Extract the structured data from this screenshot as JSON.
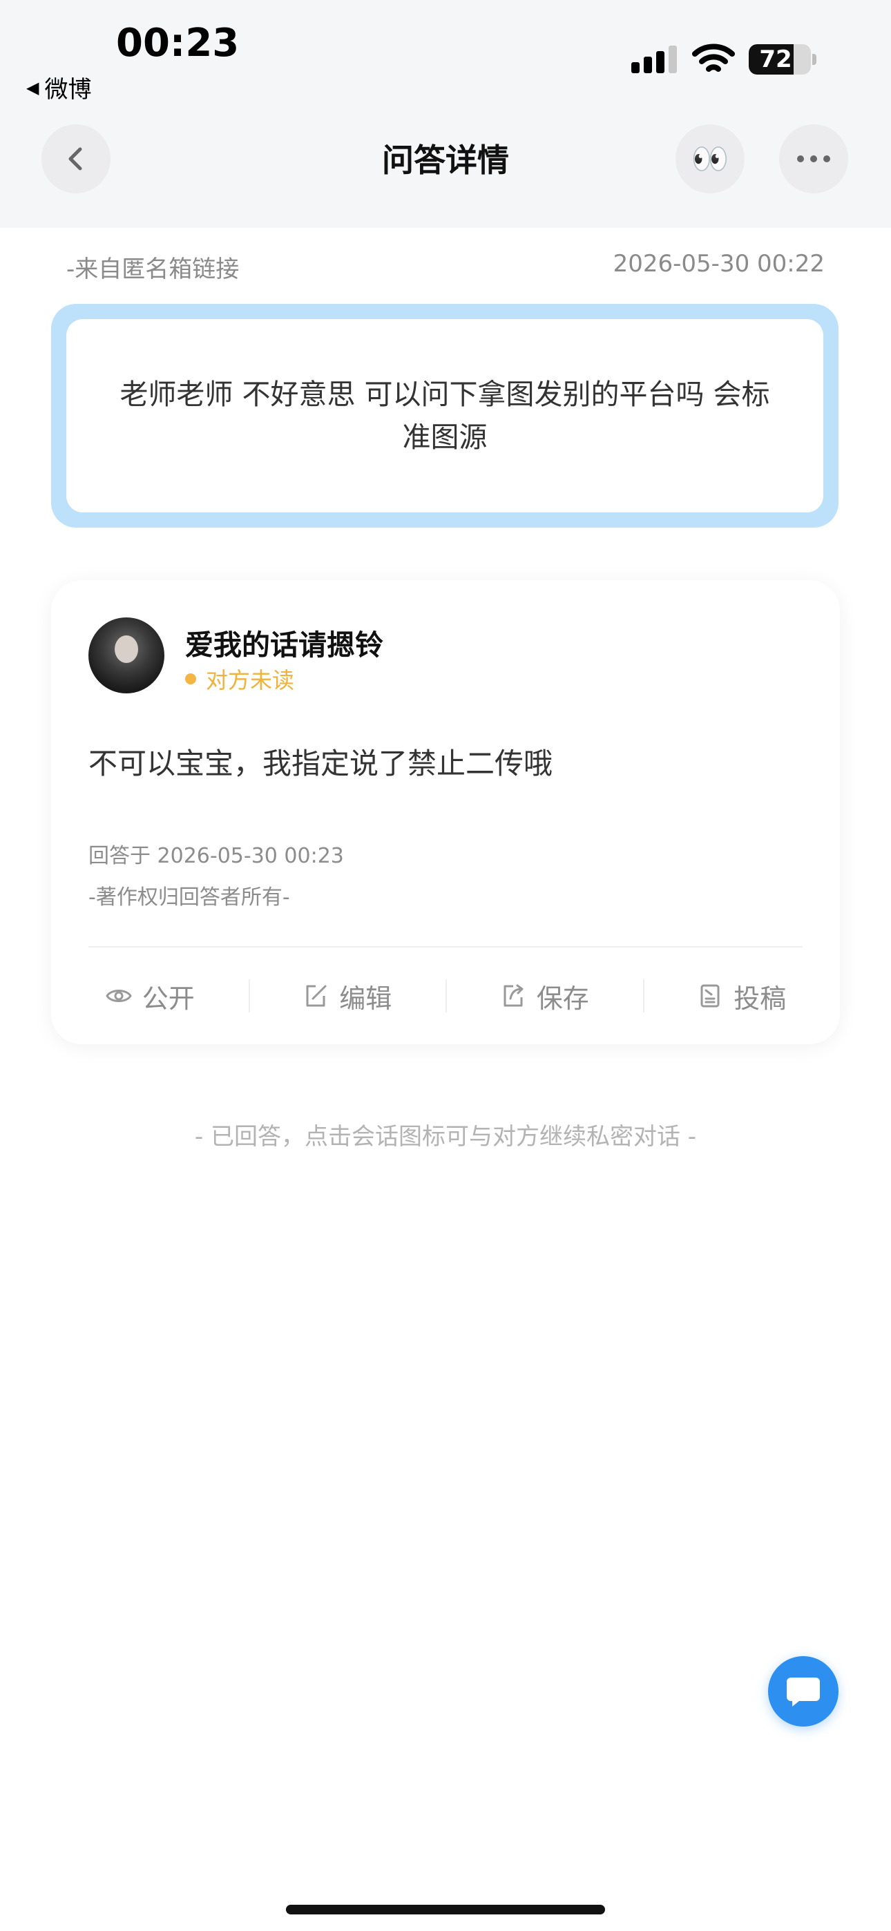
{
  "status_bar": {
    "time": "00:23",
    "back_app": "微博",
    "battery": "72",
    "battery_level": 0.72
  },
  "nav": {
    "title": "问答详情",
    "eyes_emoji": "👀"
  },
  "question": {
    "source": "-来自匿名箱链接",
    "time": "2026-05-30 00:22",
    "text": "老师老师 不好意思 可以问下拿图发别的平台吗 会标准图源"
  },
  "answer": {
    "answerer_name": "爱我的话请摁铃",
    "read_status": "对方未读",
    "text": "不可以宝宝，我指定说了禁止二传哦",
    "time": "回答于 2026-05-30 00:23",
    "copyright": "-著作权归回答者所有-",
    "actions": [
      {
        "label": "公开",
        "icon": "eye-icon"
      },
      {
        "label": "编辑",
        "icon": "edit-icon"
      },
      {
        "label": "保存",
        "icon": "share-icon"
      },
      {
        "label": "投稿",
        "icon": "document-icon"
      }
    ]
  },
  "footer_hint": "- 已回答，点击会话图标可与对方继续私密对话 -",
  "colors": {
    "accent": "#2d8ff0",
    "question_border": "#bde0fb",
    "unread": "#f0b23a"
  }
}
